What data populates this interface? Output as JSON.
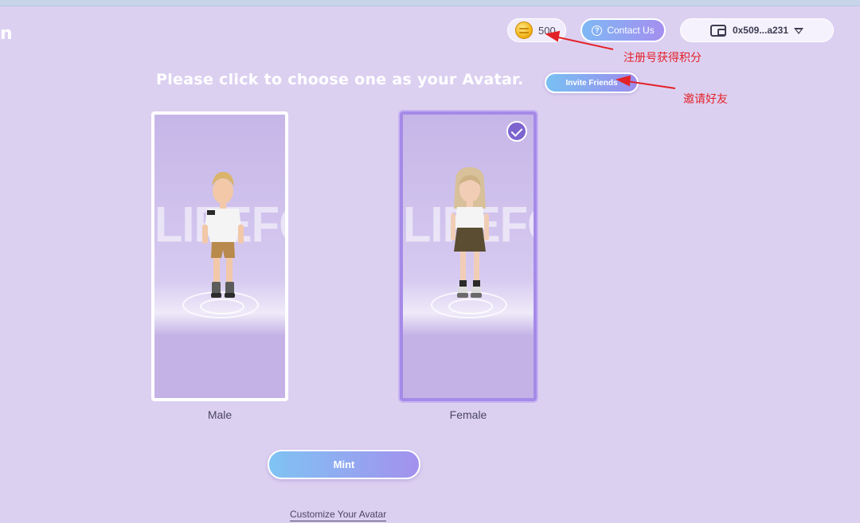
{
  "header": {
    "logo_fragment": "n",
    "points": {
      "value": "500",
      "icon": "coin-icon"
    },
    "contact": {
      "label": "Contact Us",
      "icon": "question-circle-icon"
    },
    "wallet": {
      "address": "0x509...a231",
      "icon": "wallet-icon",
      "dropdown_icon": "caret-down-icon"
    }
  },
  "main": {
    "heading": "Please click to choose one as your Avatar.",
    "invite_button": "Invite Friends",
    "cards": [
      {
        "label": "Male",
        "watermark": "LIFEFORM",
        "selected": false
      },
      {
        "label": "Female",
        "watermark": "LIFEFORM",
        "selected": true
      }
    ],
    "mint_button": "Mint",
    "customize_link": "Customize Your Avatar"
  },
  "annotations": {
    "points_note": "注册号获得积分",
    "invite_note": "邀请好友",
    "color": "#e32227"
  },
  "colors": {
    "background": "#dcd0f1",
    "accent_gradient_start": "#7fc3f3",
    "accent_gradient_end": "#a391ee",
    "selected_border": "#a58ae8"
  }
}
